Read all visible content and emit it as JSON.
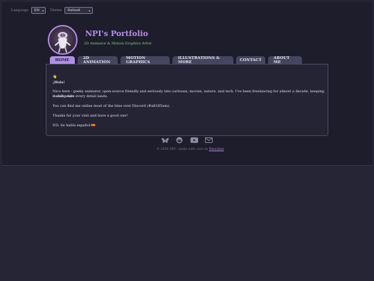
{
  "topbar": {
    "language_label": "Language",
    "language_value": "EN",
    "theme_label": "Theme",
    "theme_value": "Default"
  },
  "header": {
    "title": "NPI's Portfolio",
    "subtitle": "2D Animator & Motion Graphics Artist"
  },
  "tabs": [
    {
      "label": "HOME",
      "active": true
    },
    {
      "label": "2D ANIMATION",
      "active": false
    },
    {
      "label": "MOTION GRAPHICS",
      "active": false
    },
    {
      "label": "ILLUSTRATIONS & MORE",
      "active": false
    },
    {
      "label": "CONTACT",
      "active": false
    },
    {
      "label": "ABOUT ME",
      "active": false
    }
  ],
  "content": {
    "wave": "👋",
    "greeting": "¡Hola!",
    "para1_line1": "Nico here - geeky animator, open-source friendly and seriously into cartoons, movies, nature, and tech. I've been freelancing for almost a decade, keeping it chill while",
    "para1_line2": "making sure every detail lands.",
    "para2": "You can find me online most of the time over Discord (#alt165am).",
    "para3": "Thanks for your visit and have a good one!",
    "para4": "P.D: Se habla español",
    "flag": "🇪🇸"
  },
  "footer": {
    "icons": [
      "butterfly-icon",
      "reddit-icon",
      "youtube-icon",
      "mail-icon"
    ],
    "text": "© 2026 NPI · made with care on",
    "link": "Neocities"
  },
  "colors": {
    "accent": "#b18ee6",
    "subtitle_green": "#7fe07a",
    "page_bg": "#252536"
  }
}
